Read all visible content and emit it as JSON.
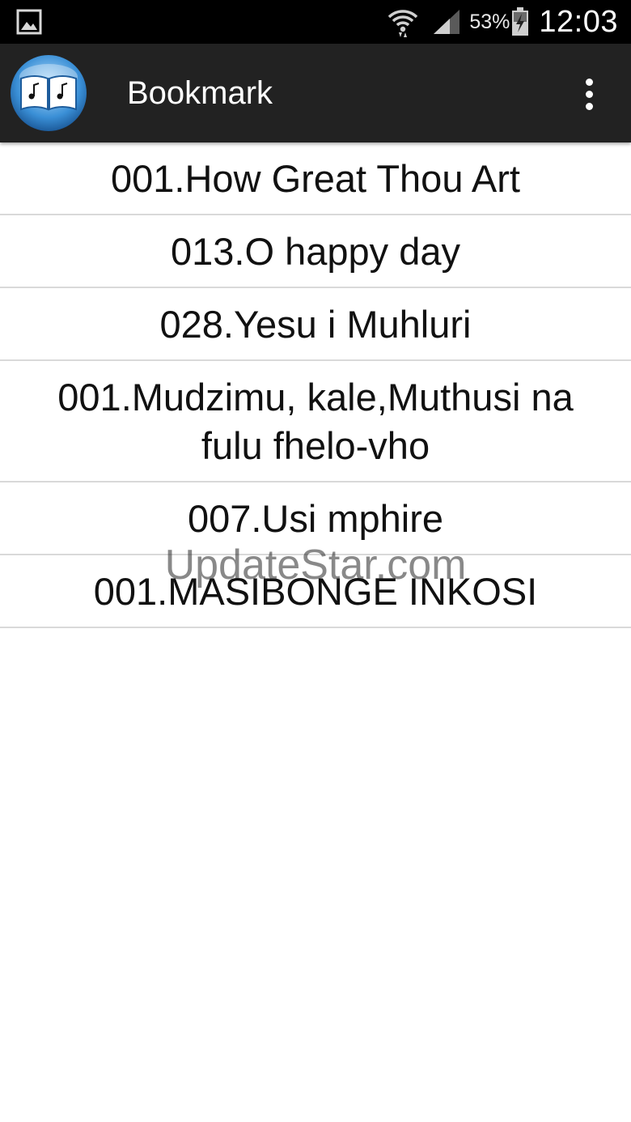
{
  "status_bar": {
    "battery_percent": "53%",
    "time": "12:03",
    "icons": [
      "gallery-icon",
      "wifi-icon",
      "signal-icon",
      "battery-charging-icon"
    ]
  },
  "action_bar": {
    "title": "Bookmark",
    "logo_icon": "songbook-icon",
    "menu_icon": "overflow-menu-icon"
  },
  "bookmarks": [
    "001.How Great Thou Art",
    "013.O happy day",
    "028.Yesu i Muhluri",
    "001.Mudzimu, kale,Muthusi na fulu fhelo-vho",
    "007.Usi mphire",
    "001.MASIBONGE INKOSI"
  ],
  "watermark": "UpdateStar.com",
  "colors": {
    "status_bar": "#000000",
    "action_bar": "#222222",
    "divider": "#d9d9d9",
    "text": "#111111"
  }
}
